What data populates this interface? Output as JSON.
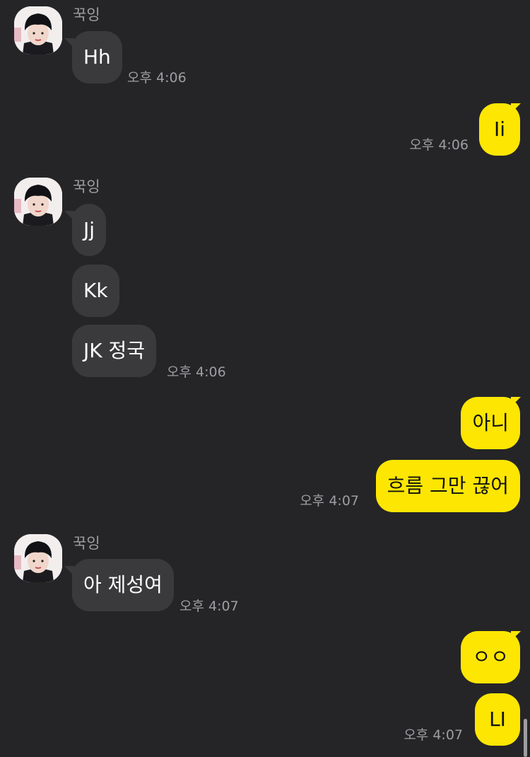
{
  "contact": {
    "name": "꾹잉"
  },
  "messages": {
    "m1": {
      "text": "Hh",
      "time": "오후 4:06"
    },
    "m2": {
      "text": "Ii",
      "time": "오후 4:06"
    },
    "m3": {
      "text": "Jj"
    },
    "m4": {
      "text": "Kk"
    },
    "m5": {
      "text": "JK 정국",
      "time": "오후 4:06"
    },
    "m6": {
      "text": "아니"
    },
    "m7": {
      "text": "흐름 그만 끊어",
      "time": "오후 4:07"
    },
    "m8": {
      "text": "아 제성여",
      "time": "오후 4:07"
    },
    "m9": {
      "text": "ㅇㅇ"
    },
    "m10": {
      "text": "LI",
      "time": "오후 4:07"
    }
  },
  "colors": {
    "background": "#252527",
    "incoming_bubble": "#3a3a3c",
    "outgoing_bubble": "#fde602",
    "meta_text": "#9e9ea2"
  }
}
